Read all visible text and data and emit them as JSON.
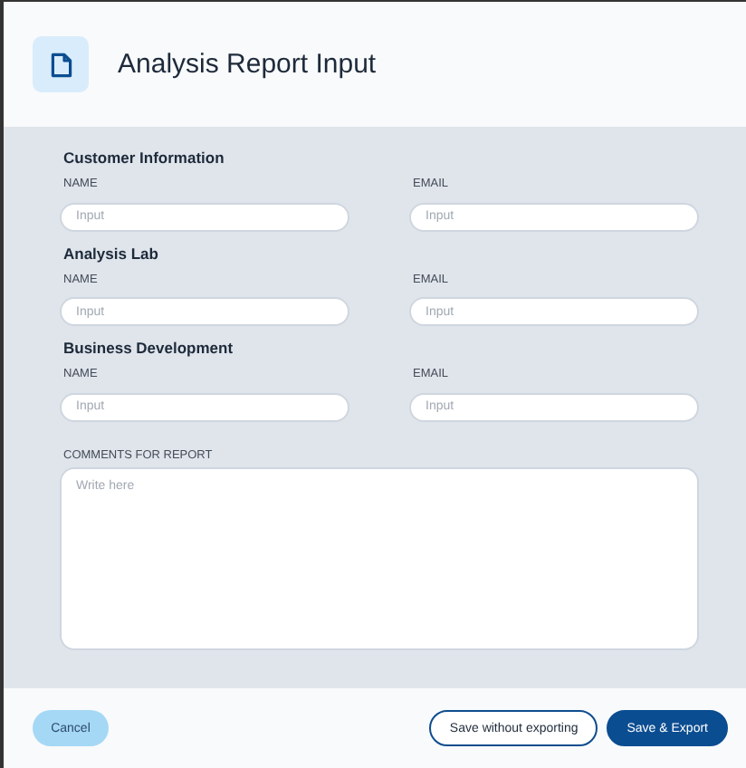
{
  "header": {
    "title": "Analysis Report Input"
  },
  "sections": [
    {
      "title": "Customer Information",
      "fields": [
        {
          "label": "NAME",
          "placeholder": "Input"
        },
        {
          "label": "EMAIL",
          "placeholder": "Input"
        }
      ]
    },
    {
      "title": "Analysis Lab",
      "fields": [
        {
          "label": "NAME",
          "placeholder": "Input"
        },
        {
          "label": "EMAIL",
          "placeholder": "Input"
        }
      ]
    },
    {
      "title": "Business Development",
      "fields": [
        {
          "label": "NAME",
          "placeholder": "Input"
        },
        {
          "label": "EMAIL",
          "placeholder": "Input"
        }
      ]
    }
  ],
  "comments": {
    "label": "COMMENTS FOR REPORT",
    "placeholder": "Write here"
  },
  "footer": {
    "cancel": "Cancel",
    "buttons": [
      {
        "label": "Save without exporting",
        "kind": "outline"
      },
      {
        "label": "Save & Export",
        "kind": "primary"
      }
    ]
  }
}
